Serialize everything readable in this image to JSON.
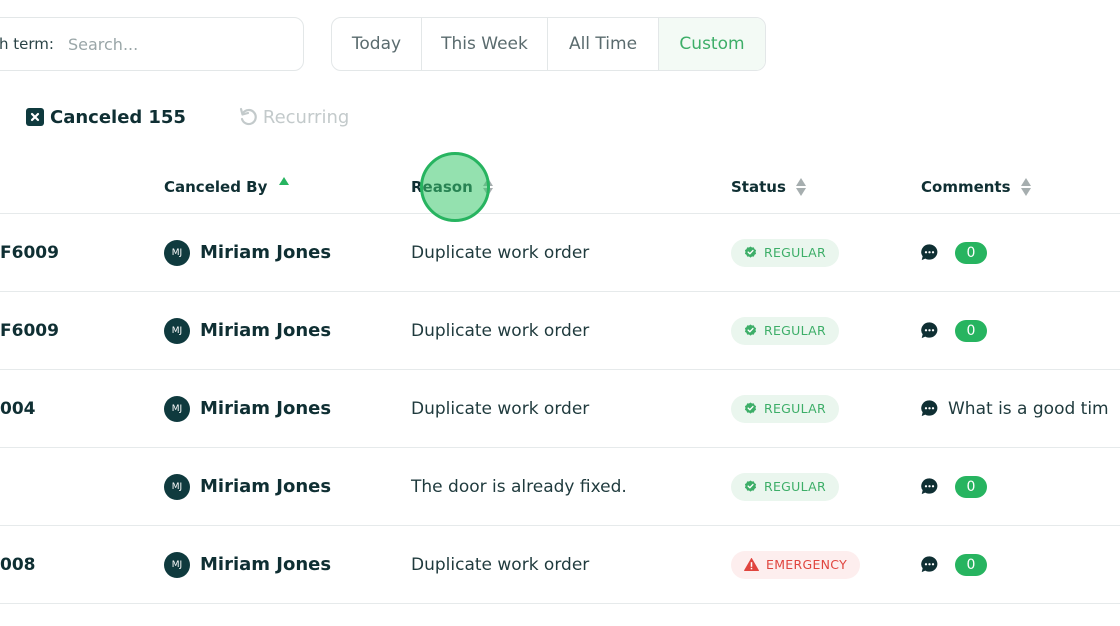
{
  "search": {
    "label": "Search term:",
    "label_visible": "h term:",
    "placeholder": "Search...",
    "value": ""
  },
  "date_range": {
    "options": [
      "Today",
      "This Week",
      "All Time",
      "Custom"
    ],
    "selected": "Custom"
  },
  "tabs": {
    "canceled": {
      "label": "Canceled",
      "count": "155",
      "icon": "x-square-icon"
    },
    "recurring": {
      "label": "Recurring",
      "icon": "rotate-ccw-icon"
    }
  },
  "table": {
    "headers": {
      "canceled_by": "Canceled By",
      "reason": "Reason",
      "status": "Status",
      "comments": "Comments"
    },
    "sort": {
      "column": "canceled_by",
      "direction": "asc"
    },
    "rows": [
      {
        "id": "F6009",
        "by_initials": "MJ",
        "by_name": "Miriam Jones",
        "reason": "Duplicate work order",
        "status": "REGULAR",
        "comment": "",
        "comment_count": "0"
      },
      {
        "id": "F6009",
        "by_initials": "MJ",
        "by_name": "Miriam Jones",
        "reason": "Duplicate work order",
        "status": "REGULAR",
        "comment": "",
        "comment_count": "0"
      },
      {
        "id": "004",
        "by_initials": "MJ",
        "by_name": "Miriam Jones",
        "reason": "Duplicate work order",
        "status": "REGULAR",
        "comment": "What is a good tim",
        "comment_count": null
      },
      {
        "id": "",
        "by_initials": "MJ",
        "by_name": "Miriam Jones",
        "reason": "The door is already fixed.",
        "status": "REGULAR",
        "comment": "",
        "comment_count": "0"
      },
      {
        "id": "008",
        "by_initials": "MJ",
        "by_name": "Miriam Jones",
        "reason": "Duplicate work order",
        "status": "EMERGENCY",
        "comment": "",
        "comment_count": "0"
      }
    ]
  },
  "colors": {
    "accent": "#27b460",
    "text_dark": "#0f2f33",
    "regular_bg": "#eaf6ee",
    "regular_fg": "#3dae68",
    "emergency_bg": "#fdeeee",
    "emergency_fg": "#e0453f"
  }
}
